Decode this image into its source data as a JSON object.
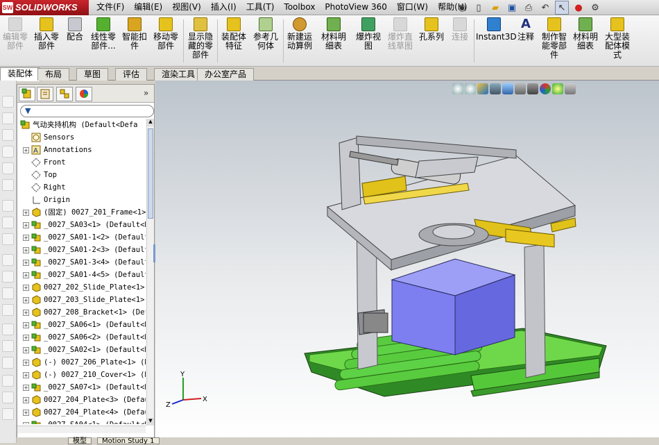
{
  "app": {
    "name": "SOLIDWORKS",
    "logo_text": "SW"
  },
  "menu": [
    "文件(F)",
    "编辑(E)",
    "视图(V)",
    "插入(I)",
    "工具(T)",
    "Toolbox",
    "PhotoView 360",
    "窗口(W)",
    "帮助(H)"
  ],
  "ribbon": {
    "edit_component": "编辑零\n部件",
    "insert_component": "插入零\n部件",
    "mate": "配合",
    "linear_pattern": "线性零\n部件...",
    "smart_fasteners": "智能扣\n件",
    "move_component": "移动零\n部件",
    "show_hidden": "显示隐\n藏的零\n部件",
    "assembly_features": "装配体\n特征",
    "reference_geometry": "参考几\n何体",
    "new_motion_study": "新建运\n动算例",
    "bom": "材料明\n细表",
    "exploded_view": "爆炸视\n图",
    "explode_line_sketch": "爆炸直\n线草图",
    "hole_series": "孔系列",
    "instant3d": "Instant3D",
    "annotation": "注释",
    "smart_component": "制作智\n能零部\n件",
    "bom2": "材料明\n细表",
    "large_assembly": "大型装\n配体模\n式"
  },
  "tabs": [
    "装配体",
    "布局",
    "草图",
    "评估",
    "渲染工具",
    "办公室产品"
  ],
  "tree": {
    "root": "气动夹持机构 (Default<Defa",
    "items": [
      {
        "label": "Sensors",
        "type": "sensor"
      },
      {
        "label": "Annotations",
        "type": "annotation",
        "expand": true
      },
      {
        "label": "Front",
        "type": "plane"
      },
      {
        "label": "Top",
        "type": "plane"
      },
      {
        "label": "Right",
        "type": "plane"
      },
      {
        "label": "Origin",
        "type": "origin"
      },
      {
        "label": "(固定) 0027_201_Frame<1>",
        "type": "part",
        "expand": true
      },
      {
        "label": "_0027_SA03<1> (Default<D",
        "type": "asm",
        "expand": true
      },
      {
        "label": "_0027_SA01-1<2> (Default",
        "type": "asm",
        "expand": true
      },
      {
        "label": "_0027_SA01-2<3> (Default",
        "type": "asm",
        "expand": true
      },
      {
        "label": "_0027_SA01-3<4> (Default",
        "type": "asm",
        "expand": true
      },
      {
        "label": "_0027_SA01-4<5> (Default",
        "type": "asm",
        "expand": true
      },
      {
        "label": "0027_202_Slide_Plate<1>",
        "type": "part",
        "expand": true
      },
      {
        "label": "0027_203_Slide_Plate<1>",
        "type": "part",
        "expand": true
      },
      {
        "label": "0027_208_Bracket<1> (Def",
        "type": "part",
        "expand": true
      },
      {
        "label": "_0027_SA06<1> (Default<D",
        "type": "asm",
        "expand": true
      },
      {
        "label": "_0027_SA06<2> (Default<D",
        "type": "asm",
        "expand": true
      },
      {
        "label": "_0027_SA02<1> (Default<D",
        "type": "asm",
        "expand": true
      },
      {
        "label": "(-) 0027_206_Plate<1> (D",
        "type": "part",
        "expand": true
      },
      {
        "label": "(-) 0027_210_Cover<1> (D",
        "type": "part",
        "expand": true
      },
      {
        "label": "_0027_SA07<1> (Default<D",
        "type": "asm",
        "expand": true
      },
      {
        "label": "0027_204_Plate<3> (Defau",
        "type": "part",
        "expand": true
      },
      {
        "label": "0027_204_Plate<4> (Defau",
        "type": "part",
        "expand": true
      },
      {
        "label": "_0027_SA04<1> (Default<D",
        "type": "asm",
        "expand": true
      }
    ]
  },
  "bottom_tabs": [
    "模型",
    "Motion Study 1"
  ],
  "axes": {
    "x": "X",
    "y": "Y",
    "z": "Z"
  },
  "colors": {
    "frame": "#b4b6bc",
    "cylinder": "#c9c9c9",
    "slider": "#e0c21a",
    "conveyor": "#55c83a",
    "box": "#7d7ff0"
  }
}
